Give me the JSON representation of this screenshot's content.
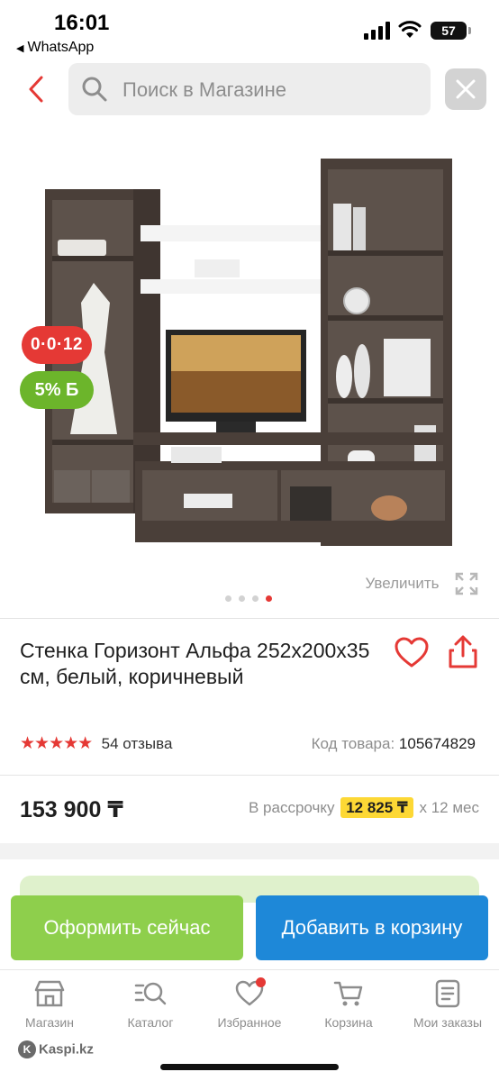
{
  "status_bar": {
    "time": "16:01",
    "back_app": "WhatsApp",
    "battery": "57"
  },
  "header": {
    "back_icon": "chevron-left-icon",
    "search_placeholder": "Поиск в Магазине",
    "close_icon": "close-icon"
  },
  "gallery": {
    "installment_badge": "0·0·12",
    "bonus_badge": "5% Б",
    "zoom_label": "Увеличить",
    "image_count": 4,
    "active_image": 4
  },
  "product": {
    "title": "Стенка Горизонт Альфа 252x200x35 см, белый, коричневый",
    "rating_stars": "★★★★★",
    "rating_value": 5,
    "reviews": "54 отзыва",
    "code_label": "Код товара:",
    "code_value": "105674829",
    "price": "153 900 ₸",
    "installment_label": "В рассрочку",
    "monthly_payment": "12 825 ₸",
    "installment_term": "x 12 мес"
  },
  "actions": {
    "buy_now": "Оформить сейчас",
    "add_to_cart": "Добавить в корзину"
  },
  "tabbar": {
    "items": [
      {
        "label": "Магазин",
        "icon": "store-icon"
      },
      {
        "label": "Каталог",
        "icon": "catalog-search-icon"
      },
      {
        "label": "Избранное",
        "icon": "heart-icon"
      },
      {
        "label": "Корзина",
        "icon": "cart-icon"
      },
      {
        "label": "Мои заказы",
        "icon": "orders-icon"
      }
    ]
  },
  "footer": {
    "brand": "Kaspi.kz"
  },
  "colors": {
    "accent_red": "#e53935",
    "bonus_green": "#6cb52b",
    "buy_green": "#8ecf4c",
    "cart_blue": "#1e88d8",
    "installment_yellow": "#fdd835"
  }
}
